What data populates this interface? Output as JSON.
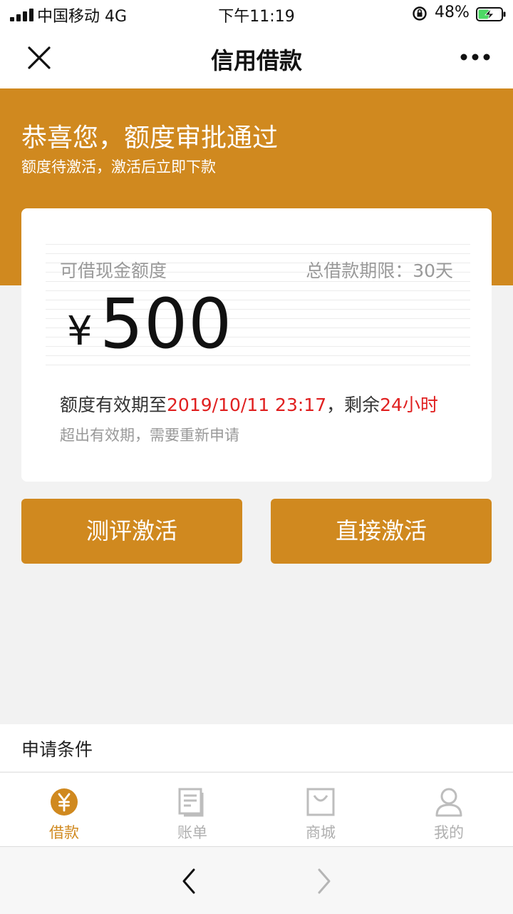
{
  "status_bar": {
    "carrier": "中国移动 4G",
    "time": "下午11:19",
    "battery_percent": "48%",
    "battery_level": 0.48
  },
  "nav": {
    "title": "信用借款",
    "close_icon": "close-icon",
    "more_icon": "more-icon"
  },
  "hero": {
    "title": "恭喜您，额度审批通过",
    "subtitle": "额度待激活，激活后立即下款"
  },
  "card": {
    "label": "可借现金额度",
    "term": "总借款期限：30天",
    "currency": "¥",
    "amount": "500",
    "valid_prefix": "额度有效期至",
    "valid_date": "2019/10/11 23:17",
    "valid_sep": "，剩余",
    "valid_remaining": "24小时",
    "note": "超出有效期，需要重新申请"
  },
  "buttons": {
    "evaluate": "测评激活",
    "direct": "直接激活"
  },
  "conditions": {
    "title": "申请条件"
  },
  "tabs": [
    {
      "label": "借款",
      "icon": "yen-circle-icon",
      "active": true
    },
    {
      "label": "账单",
      "icon": "bill-icon",
      "active": false
    },
    {
      "label": "商城",
      "icon": "shopping-bag-icon",
      "active": false
    },
    {
      "label": "我的",
      "icon": "user-icon",
      "active": false
    }
  ],
  "colors": {
    "accent": "#d0891f",
    "highlight_red": "#e02020",
    "background": "#f2f2f2"
  }
}
